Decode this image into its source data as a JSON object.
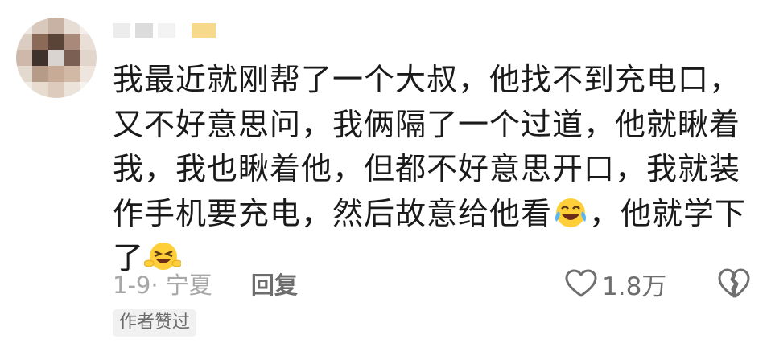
{
  "comment": {
    "lines": [
      "我最近就刚帮了一个大叔，他找不到充电口，",
      "又不好意思问，我俩隔了一个过道，他就瞅着",
      "我，我也瞅着他，但都不好意思开口，我就装",
      "作手机要充电，然后故意给他看",
      "，他就学下",
      "了"
    ],
    "emoji_1": "laughing-tears-emoji-icon",
    "emoji_2": "winking-grin-emoji-icon"
  },
  "meta": {
    "date_location": "1-9· 宁夏",
    "reply_label": "回复",
    "like_count": "1.8万"
  },
  "badge": {
    "author_liked": "作者赞过"
  },
  "icons": {
    "like": "heart-outline-icon",
    "dislike": "broken-heart-icon"
  },
  "colors": {
    "meta_text": "#a7a7a7",
    "reply_text": "#6d6d6d",
    "badge_bg": "#f1f1f1"
  }
}
